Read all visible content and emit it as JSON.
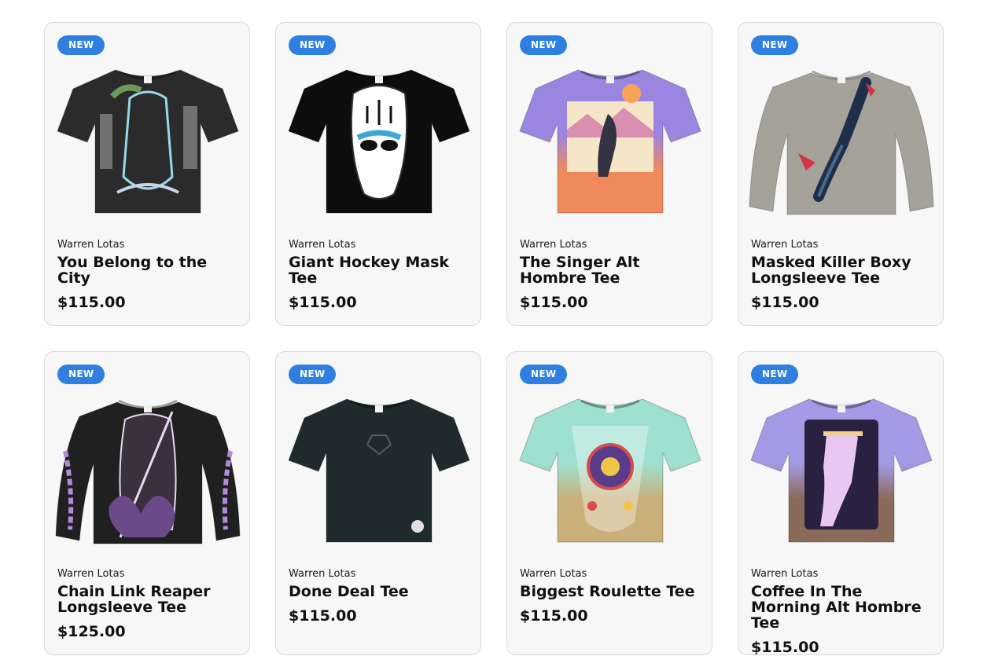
{
  "products": [
    {
      "badge": "NEW",
      "brand": "Warren Lotas",
      "title": "You Belong to the City",
      "price": "$115.00",
      "shirt_color": "#2b2b2b",
      "sleeves": "short",
      "art_colors": [
        "#9ad7e8",
        "#6a9b5a",
        "#c9d6e8"
      ],
      "icon": "tee-city-graphic"
    },
    {
      "badge": "NEW",
      "brand": "Warren Lotas",
      "title": "Giant Hockey Mask Tee",
      "price": "$115.00",
      "shirt_color": "#0d0d0d",
      "sleeves": "short",
      "art_colors": [
        "#ffffff",
        "#3aa7d8",
        "#111111"
      ],
      "icon": "tee-hockey-mask"
    },
    {
      "badge": "NEW",
      "brand": "Warren Lotas",
      "title": "The Singer Alt Hombre Tee",
      "price": "$115.00",
      "shirt_color": "#9a86e0",
      "shirt_bottom": "#f08a5d",
      "sleeves": "short",
      "art_colors": [
        "#f5e6c8",
        "#333344",
        "#d88fb0"
      ],
      "icon": "tee-singer"
    },
    {
      "badge": "NEW",
      "brand": "Warren Lotas",
      "title": "Masked Killer Boxy Longsleeve Tee",
      "price": "$115.00",
      "shirt_color": "#a5a299",
      "sleeves": "long",
      "art_colors": [
        "#1f2f4a",
        "#d6334a",
        "#4a6a8a"
      ],
      "icon": "longsleeve-masked-killer"
    },
    {
      "badge": "NEW",
      "brand": "Warren Lotas",
      "title": "Chain Link Reaper Longsleeve Tee",
      "price": "$125.00",
      "shirt_color": "#202020",
      "sleeves": "long",
      "art_colors": [
        "#b58ad8",
        "#e8d8f0",
        "#6b4a8a"
      ],
      "icon": "longsleeve-reaper"
    },
    {
      "badge": "NEW",
      "brand": "Warren Lotas",
      "title": "Done Deal Tee",
      "price": "$115.00",
      "shirt_color": "#1f2a2c",
      "sleeves": "short",
      "art_colors": [
        "#555e60",
        "#e0e0e0",
        "#555e60"
      ],
      "icon": "tee-done-deal"
    },
    {
      "badge": "NEW",
      "brand": "Warren Lotas",
      "title": "Biggest Roulette Tee",
      "price": "$115.00",
      "shirt_color": "#9ee0cf",
      "shirt_bottom": "#c9b07a",
      "sleeves": "short",
      "art_colors": [
        "#5a3d8a",
        "#d94a4a",
        "#f0c64a"
      ],
      "icon": "tee-roulette"
    },
    {
      "badge": "NEW",
      "brand": "Warren Lotas",
      "title": "Coffee In The Morning Alt Hombre Tee",
      "price": "$115.00",
      "shirt_color": "#a49ae6",
      "shirt_bottom": "#8a6a58",
      "sleeves": "short",
      "art_colors": [
        "#2a2040",
        "#e8c8f0",
        "#6a5a9a"
      ],
      "icon": "tee-coffee-morning"
    }
  ]
}
